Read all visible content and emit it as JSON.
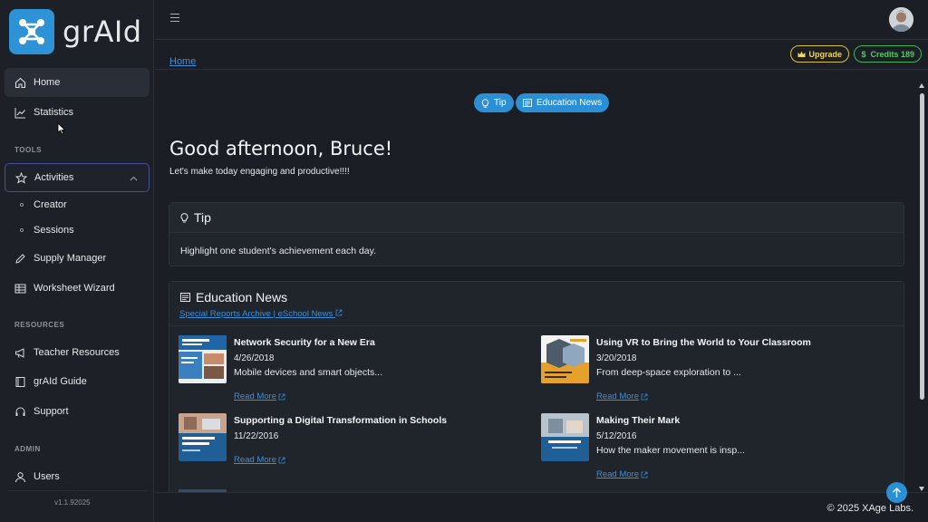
{
  "app": {
    "name": "grAId"
  },
  "sidebar": {
    "items": {
      "home": "Home",
      "statistics": "Statistics",
      "activities": "Activities",
      "creator": "Creator",
      "sessions": "Sessions",
      "supply_manager": "Supply Manager",
      "worksheet_wizard": "Worksheet Wizard",
      "teacher_resources": "Teacher Resources",
      "graid_guide": "grAId Guide",
      "support": "Support",
      "users": "Users"
    },
    "sections": {
      "tools": "TOOLS",
      "resources": "RESOURCES",
      "admin": "ADMIN"
    },
    "version": "v1.1.92025"
  },
  "header": {
    "breadcrumb": "Home",
    "upgrade": "Upgrade",
    "credits": "Credits 189"
  },
  "main": {
    "pills": {
      "tip": "Tip",
      "news": "Education News"
    },
    "greeting": "Good afternoon, Bruce!",
    "subtitle": "Let's make today engaging and productive!!!!",
    "tip": {
      "title": "Tip",
      "body": "Highlight one student's achievement each day."
    },
    "news": {
      "title": "Education News",
      "archive_link": "Special Reports Archive | eSchool News",
      "read_more": "Read More",
      "items": [
        {
          "title": "Network Security for a New Era",
          "date": "4/26/2018",
          "desc": "Mobile devices and smart objects..."
        },
        {
          "title": "Using VR to Bring the World to Your Classroom",
          "date": "3/20/2018",
          "desc": "From deep-space exploration to ..."
        },
        {
          "title": "Supporting a Digital Transformation in Schools",
          "date": "11/22/2016",
          "desc": ""
        },
        {
          "title": "Making Their Mark",
          "date": "5/12/2016",
          "desc": "How the maker movement is insp..."
        }
      ]
    }
  },
  "footer": {
    "copyright": "© 2025 XAge Labs."
  },
  "colors": {
    "accent": "#2b8fd6",
    "link": "#3d8fd9",
    "upgrade": "#f0d65a",
    "credits": "#57c96c"
  }
}
